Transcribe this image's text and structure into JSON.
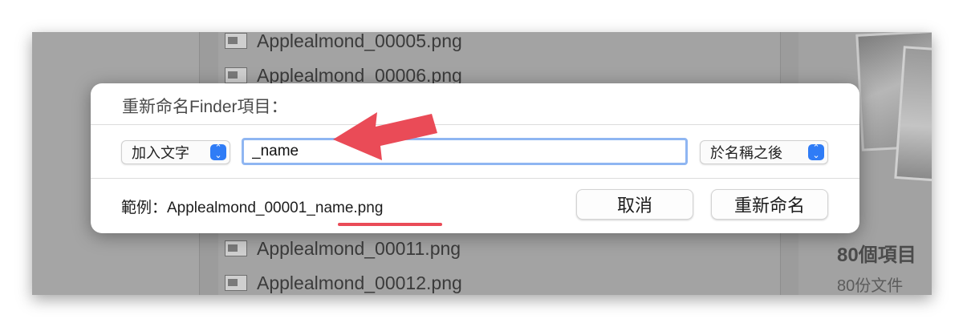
{
  "background_files": {
    "top": [
      "Applealmond_00005.png",
      "Applealmond_00006.png"
    ],
    "bottom": [
      "Applealmond_00011.png",
      "Applealmond_00012.png"
    ]
  },
  "info_panel": {
    "item_count": "80個項目",
    "item_kind": "80份文件"
  },
  "dialog": {
    "title": "重新命名Finder項目：",
    "action_select": "加入文字",
    "text_value": "_name",
    "position_select": "於名稱之後",
    "example_label": "範例：Applealmond_00001_name.png",
    "cancel_label": "取消",
    "rename_label": "重新命名"
  },
  "colors": {
    "accent": "#2f7cf6",
    "annotation_red": "#ea4b57"
  },
  "icons": {
    "stepper": "chevron-updown-icon",
    "file": "image-file-icon",
    "annotation": "red-arrow-icon"
  }
}
